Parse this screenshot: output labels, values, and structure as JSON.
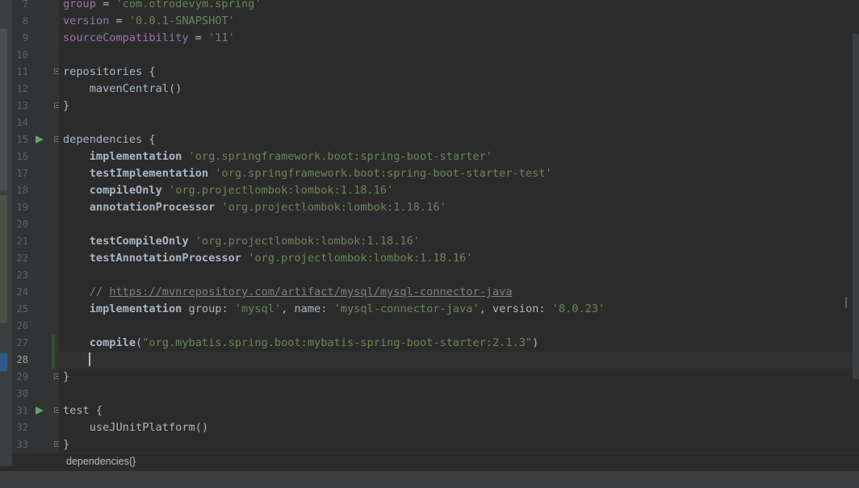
{
  "editor": {
    "current_line": 28,
    "lines": [
      {
        "n": "7",
        "tokens": [
          [
            "prop",
            "group"
          ],
          [
            "plain",
            " = "
          ],
          [
            "str",
            "'com.otrodevym.spring'"
          ]
        ]
      },
      {
        "n": "8",
        "tokens": [
          [
            "prop",
            "version"
          ],
          [
            "plain",
            " = "
          ],
          [
            "str",
            "'0.0.1-SNAPSHOT'"
          ]
        ]
      },
      {
        "n": "9",
        "tokens": [
          [
            "prop",
            "sourceCompatibility"
          ],
          [
            "plain",
            " = "
          ],
          [
            "str",
            "'11'"
          ]
        ]
      },
      {
        "n": "10",
        "tokens": []
      },
      {
        "n": "11",
        "tokens": [
          [
            "fn",
            "repositories"
          ],
          [
            "plain",
            " {"
          ]
        ]
      },
      {
        "n": "12",
        "tokens": [
          [
            "plain",
            "    "
          ],
          [
            "fn",
            "mavenCentral"
          ],
          [
            "plain",
            "()"
          ]
        ]
      },
      {
        "n": "13",
        "tokens": [
          [
            "plain",
            "}"
          ]
        ]
      },
      {
        "n": "14",
        "tokens": []
      },
      {
        "n": "15",
        "tokens": [
          [
            "fn",
            "dependencies"
          ],
          [
            "plain",
            " {"
          ]
        ]
      },
      {
        "n": "16",
        "tokens": [
          [
            "plain",
            "    "
          ],
          [
            "method",
            "implementation"
          ],
          [
            "plain",
            " "
          ],
          [
            "str",
            "'org.springframework.boot:spring-boot-starter'"
          ]
        ]
      },
      {
        "n": "17",
        "tokens": [
          [
            "plain",
            "    "
          ],
          [
            "method",
            "testImplementation"
          ],
          [
            "plain",
            " "
          ],
          [
            "str",
            "'org.springframework.boot:spring-boot-starter-test'"
          ]
        ]
      },
      {
        "n": "18",
        "tokens": [
          [
            "plain",
            "    "
          ],
          [
            "method",
            "compileOnly"
          ],
          [
            "plain",
            " "
          ],
          [
            "str",
            "'org.projectlombok:lombok:1.18.16'"
          ]
        ]
      },
      {
        "n": "19",
        "tokens": [
          [
            "plain",
            "    "
          ],
          [
            "method",
            "annotationProcessor"
          ],
          [
            "plain",
            " "
          ],
          [
            "str",
            "'org.projectlombok:lombok:1.18.16'"
          ]
        ]
      },
      {
        "n": "20",
        "tokens": []
      },
      {
        "n": "21",
        "tokens": [
          [
            "plain",
            "    "
          ],
          [
            "method",
            "testCompileOnly"
          ],
          [
            "plain",
            " "
          ],
          [
            "str",
            "'org.projectlombok:lombok:1.18.16'"
          ]
        ]
      },
      {
        "n": "22",
        "tokens": [
          [
            "plain",
            "    "
          ],
          [
            "method",
            "testAnnotationProcessor"
          ],
          [
            "plain",
            " "
          ],
          [
            "str",
            "'org.projectlombok:lombok:1.18.16'"
          ]
        ]
      },
      {
        "n": "23",
        "tokens": []
      },
      {
        "n": "24",
        "tokens": [
          [
            "plain",
            "    "
          ],
          [
            "comment",
            "// "
          ],
          [
            "link",
            "https://mvnrepository.com/artifact/mysql/mysql-connector-java"
          ]
        ]
      },
      {
        "n": "25",
        "tokens": [
          [
            "plain",
            "    "
          ],
          [
            "method",
            "implementation"
          ],
          [
            "plain",
            " "
          ],
          [
            "named",
            "group"
          ],
          [
            "plain",
            ": "
          ],
          [
            "str",
            "'mysql'"
          ],
          [
            "plain",
            ", "
          ],
          [
            "named",
            "name"
          ],
          [
            "plain",
            ": "
          ],
          [
            "str",
            "'mysql-connector-java'"
          ],
          [
            "plain",
            ", "
          ],
          [
            "named",
            "version"
          ],
          [
            "plain",
            ": "
          ],
          [
            "str",
            "'8.0.23'"
          ]
        ]
      },
      {
        "n": "26",
        "tokens": []
      },
      {
        "n": "27",
        "tokens": [
          [
            "plain",
            "    "
          ],
          [
            "method",
            "compile"
          ],
          [
            "plain",
            "("
          ],
          [
            "str",
            "\"org.mybatis.spring.boot:mybatis-spring-boot-starter:2.1.3\""
          ],
          [
            "plain",
            ")"
          ]
        ]
      },
      {
        "n": "28",
        "tokens": []
      },
      {
        "n": "29",
        "tokens": [
          [
            "plain",
            "}"
          ]
        ]
      },
      {
        "n": "30",
        "tokens": []
      },
      {
        "n": "31",
        "tokens": [
          [
            "fn",
            "test"
          ],
          [
            "plain",
            " {"
          ]
        ]
      },
      {
        "n": "32",
        "tokens": [
          [
            "plain",
            "    "
          ],
          [
            "fn",
            "useJUnitPlatform"
          ],
          [
            "plain",
            "()"
          ]
        ]
      },
      {
        "n": "33",
        "tokens": [
          [
            "plain",
            "}"
          ]
        ]
      }
    ]
  },
  "gutter": {
    "run_icon_lines": [
      "15",
      "31"
    ],
    "fold_icon_lines": [
      "11",
      "13",
      "15",
      "29",
      "31",
      "33"
    ],
    "changed_lines": [
      "27",
      "28"
    ]
  },
  "breadcrumb": {
    "path": "dependencies{}"
  },
  "colors": {
    "background": "#2b2b2b",
    "gutter": "#313335",
    "string": "#6a8759",
    "property": "#9876aa",
    "comment": "#808080",
    "run_icon": "#59a869"
  }
}
